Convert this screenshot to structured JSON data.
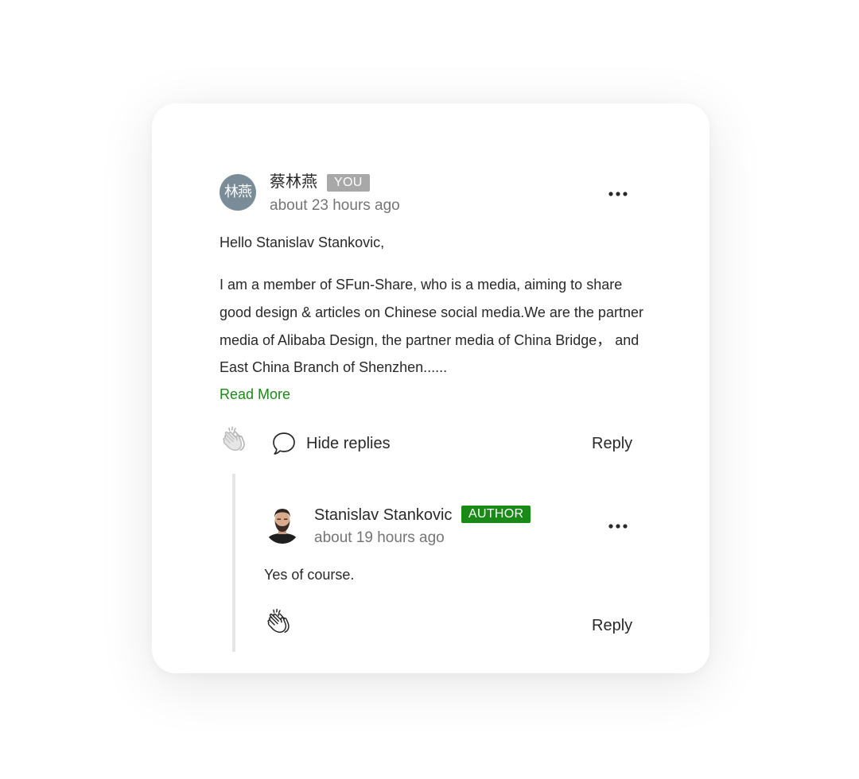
{
  "comment": {
    "avatar_initials": "林燕",
    "author_name": "蔡林燕",
    "badge": "YOU",
    "timestamp": "about 23 hours ago",
    "more_label": "More options",
    "greeting": "Hello Stanislav Stankovic,",
    "body": "I am a member of SFun-Share, who is a media, aiming to share good design & articles on Chinese social media.We are the partner media of Alibaba Design, the partner media of China Bridge， and East China Branch of Shenzhen......",
    "read_more": "Read More",
    "hide_replies": "Hide replies",
    "reply": "Reply"
  },
  "reply_comment": {
    "author_name": "Stanislav Stankovic",
    "badge": "AUTHOR",
    "timestamp": "about 19 hours ago",
    "body": "Yes of course.",
    "reply": "Reply"
  },
  "colors": {
    "accent_green": "#1a8917",
    "you_badge": "#a8a8a8",
    "avatar_bg": "#7a8c98",
    "text": "#292929",
    "muted": "#757575"
  },
  "icons": {
    "clap": "clap-icon",
    "speech_bubble": "speech-bubble-icon",
    "more": "more-horizontal-icon"
  }
}
